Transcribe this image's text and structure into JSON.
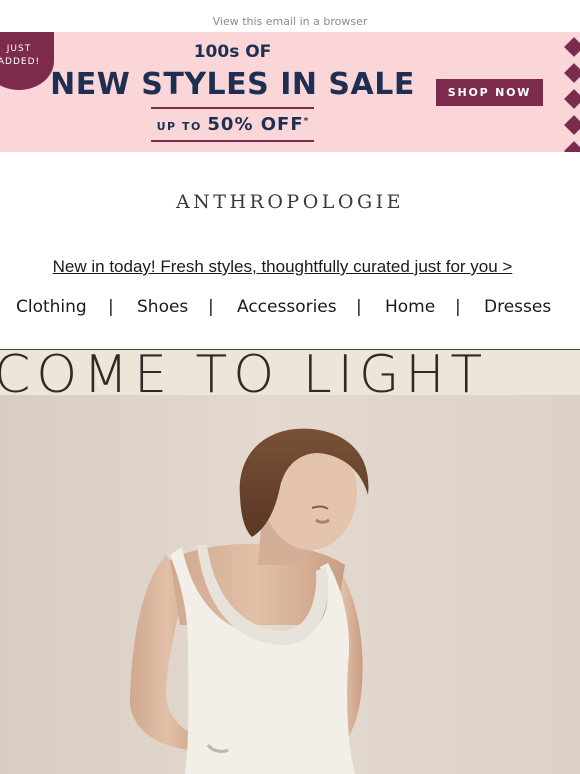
{
  "header": {
    "browser_link": "View this email in a browser"
  },
  "banner": {
    "badge": [
      "JUST",
      "ADDED!"
    ],
    "line1": "100s OF",
    "line2": "NEW STYLES IN SALE",
    "line3_prefix": "UP TO",
    "line3_main": "50% OFF",
    "line3_mark": "*",
    "cta": "SHOP NOW",
    "colors": {
      "background": "#fbd6d9",
      "accent": "#7c2b4c",
      "text": "#1f2f52"
    }
  },
  "brand": {
    "logo": "ANTHROPOLOGIE"
  },
  "promo": {
    "link_text": "New in today! Fresh styles, thoughtfully curated just for you >"
  },
  "nav": {
    "items": [
      "Clothing",
      "Shoes",
      "Accessories",
      "Home",
      "Dresses"
    ],
    "separator": "|"
  },
  "hero": {
    "headline": "COME TO LIGHT",
    "colors": {
      "band": "#ebe6d8",
      "text": "#2f2a24"
    }
  }
}
